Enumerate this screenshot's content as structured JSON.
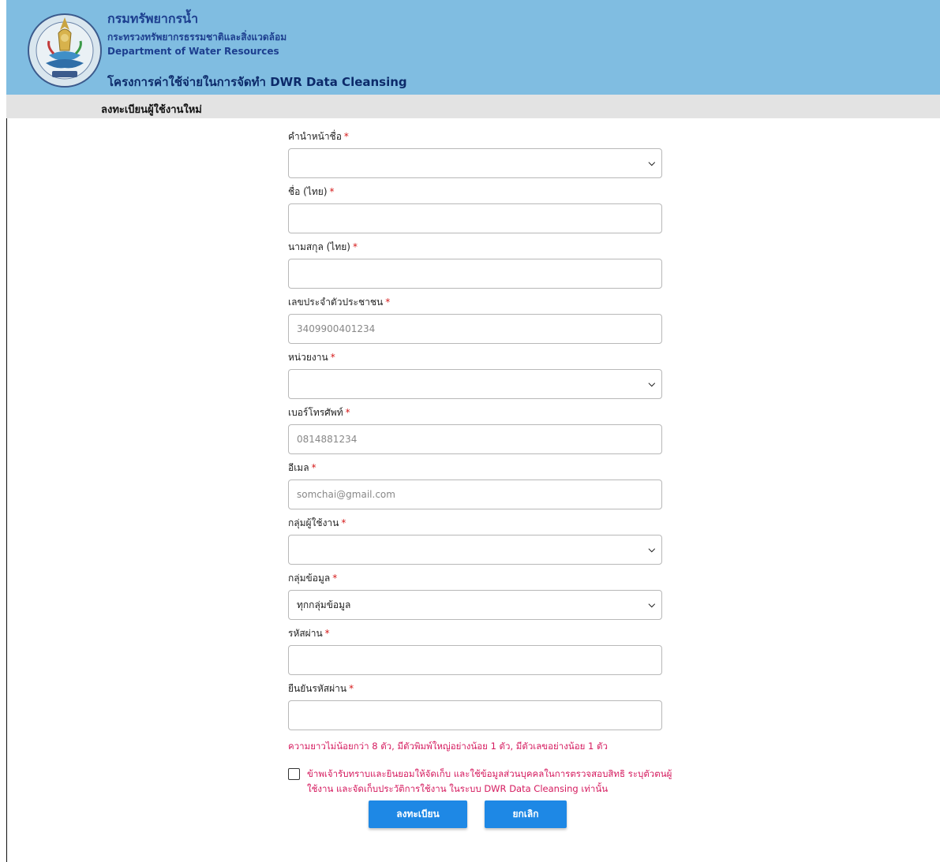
{
  "header": {
    "org_name_th": "กรมทรัพยากรน้ำ",
    "ministry_th": "กระทรวงทรัพยากรธรรมชาติและสิ่งแวดล้อม",
    "org_name_en": "Department of Water Resources",
    "project_title": "โครงการค่าใช้จ่ายในการจัดทำ DWR Data Cleansing",
    "logo_icon": "dwr-emblem-icon"
  },
  "subbar": {
    "title": "ลงทะเบียนผู้ใช้งานใหม่"
  },
  "form": {
    "title_prefix": {
      "label": "คำนำหน้าชื่อ",
      "value": ""
    },
    "first_name": {
      "label": "ชื่อ (ไทย)",
      "value": ""
    },
    "last_name": {
      "label": "นามสกุล (ไทย)",
      "value": ""
    },
    "citizen_id": {
      "label": "เลขประจำตัวประชาชน",
      "placeholder": "3409900401234"
    },
    "department": {
      "label": "หน่วยงาน",
      "value": ""
    },
    "phone": {
      "label": "เบอร์โทรศัพท์",
      "placeholder": "0814881234"
    },
    "email": {
      "label": "อีเมล",
      "placeholder": "somchai@gmail.com"
    },
    "user_group": {
      "label": "กลุ่มผู้ใช้งาน",
      "value": ""
    },
    "data_group": {
      "label": "กลุ่มข้อมูล",
      "value": "ทุกกลุ่มข้อมูล"
    },
    "password": {
      "label": "รหัสผ่าน",
      "value": ""
    },
    "confirm_password": {
      "label": "ยืนยันรหัสผ่าน",
      "value": ""
    },
    "required_mark": "*",
    "password_hint": "ความยาวไม่น้อยกว่า 8 ตัว,   มีตัวพิมพ์ใหญ่อย่างน้อย 1 ตัว,   มีตัวเลขอย่างน้อย 1 ตัว",
    "consent_text": "ข้าพเจ้ารับทราบและยินยอมให้จัดเก็บ และใช้ข้อมูลส่วนบุคคลในการตรวจสอบสิทธิ ระบุตัวตนผู้ใช้งาน และจัดเก็บประวัติการใช้งาน ในระบบ DWR Data Cleansing เท่านั้น",
    "chevron_icon": "chevron-down-icon"
  },
  "buttons": {
    "register": "ลงทะเบียน",
    "cancel": "ยกเลิก"
  }
}
